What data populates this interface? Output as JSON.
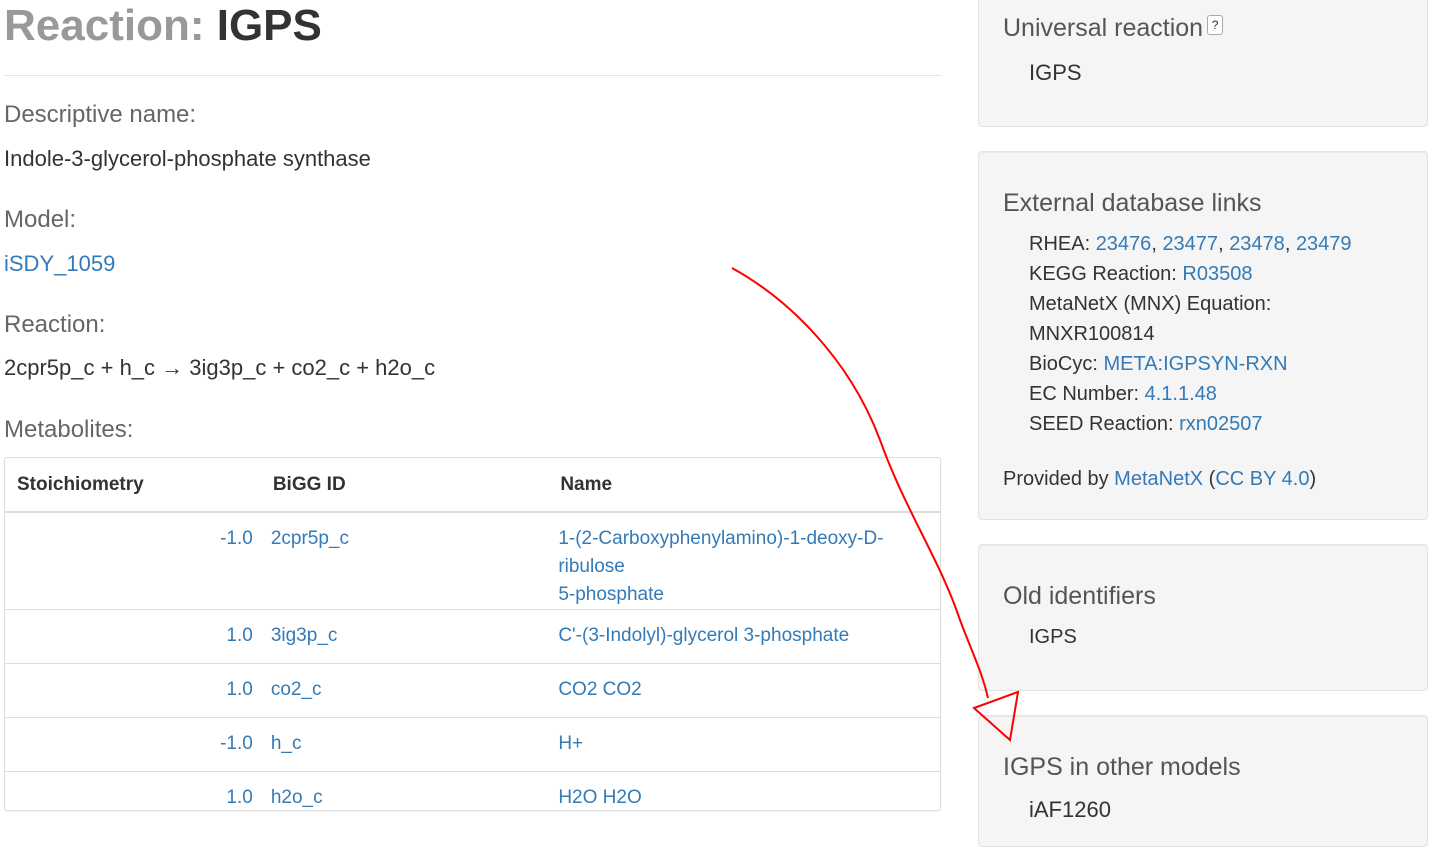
{
  "page": {
    "title_prefix": "Reaction:",
    "title_id": "IGPS"
  },
  "descriptive": {
    "label": "Descriptive name:",
    "value": "Indole-3-glycerol-phosphate synthase"
  },
  "model": {
    "label": "Model:",
    "value": "iSDY_1059"
  },
  "reaction": {
    "label": "Reaction:",
    "equation": "2cpr5p_c + h_c → 3ig3p_c + co2_c + h2o_c"
  },
  "metabolites": {
    "label": "Metabolites:",
    "headers": [
      "Stoichiometry",
      "BiGG ID",
      "Name"
    ],
    "rows": [
      {
        "stoich": "-1.0",
        "bigg": "2cpr5p_c",
        "name_line1": "1-(2-Carboxyphenylamino)-1-deoxy-D-ribulose",
        "name_line2": "5-phosphate"
      },
      {
        "stoich": "1.0",
        "bigg": "3ig3p_c",
        "name_line1": "C'-(3-Indolyl)-glycerol 3-phosphate",
        "name_line2": ""
      },
      {
        "stoich": "1.0",
        "bigg": "co2_c",
        "name_line1": "CO2 CO2",
        "name_line2": ""
      },
      {
        "stoich": "-1.0",
        "bigg": "h_c",
        "name_line1": "H+",
        "name_line2": ""
      },
      {
        "stoich": "1.0",
        "bigg": "h2o_c",
        "name_line1": "H2O H2O",
        "name_line2": ""
      }
    ]
  },
  "universal": {
    "heading": "Universal reaction",
    "help": "?",
    "link": "IGPS"
  },
  "external": {
    "heading": "External database links",
    "rhea_label": "RHEA: ",
    "rhea_ids": [
      "23476",
      "23477",
      "23478",
      "23479"
    ],
    "sep": ", ",
    "kegg_label": "KEGG Reaction: ",
    "kegg_id": "R03508",
    "mnx_label": "MetaNetX (MNX) Equation:",
    "mnx_id": "MNXR100814",
    "biocyc_label": "BioCyc: ",
    "biocyc_id": "META:IGPSYN-RXN",
    "ec_label": "EC Number: ",
    "ec_id": "4.1.1.48",
    "seed_label": "SEED Reaction: ",
    "seed_id": "rxn02507",
    "provided_prefix": "Provided by ",
    "provided_link": "MetaNetX",
    "provided_open": " (",
    "license_link": "CC BY 4.0",
    "provided_close": ")"
  },
  "old": {
    "heading": "Old identifiers",
    "value": "IGPS"
  },
  "other_models": {
    "heading": "IGPS in other models",
    "first_model": "iAF1260"
  },
  "colors": {
    "link": "#337ab7",
    "annotation": "#ff0000",
    "panel_bg": "#f5f5f5"
  }
}
